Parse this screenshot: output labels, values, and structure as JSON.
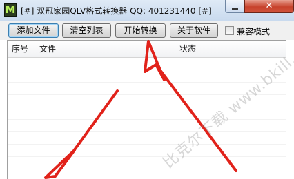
{
  "window": {
    "title": "[#] 双冠家园QLV格式转换器 QQ: 401231440 [#]",
    "icon_letter": "M",
    "close_glyph": "✕"
  },
  "toolbar": {
    "add_file": "添加文件",
    "clear_list": "清空列表",
    "start_convert": "开始转换",
    "about": "关于软件",
    "compat_mode": "兼容模式",
    "compat_checked": false
  },
  "list": {
    "columns": [
      "序号",
      "文件",
      "状态"
    ],
    "rows": []
  },
  "watermark": "比克尔下载 www.bkill.com",
  "annotation_color": "#e1221a"
}
